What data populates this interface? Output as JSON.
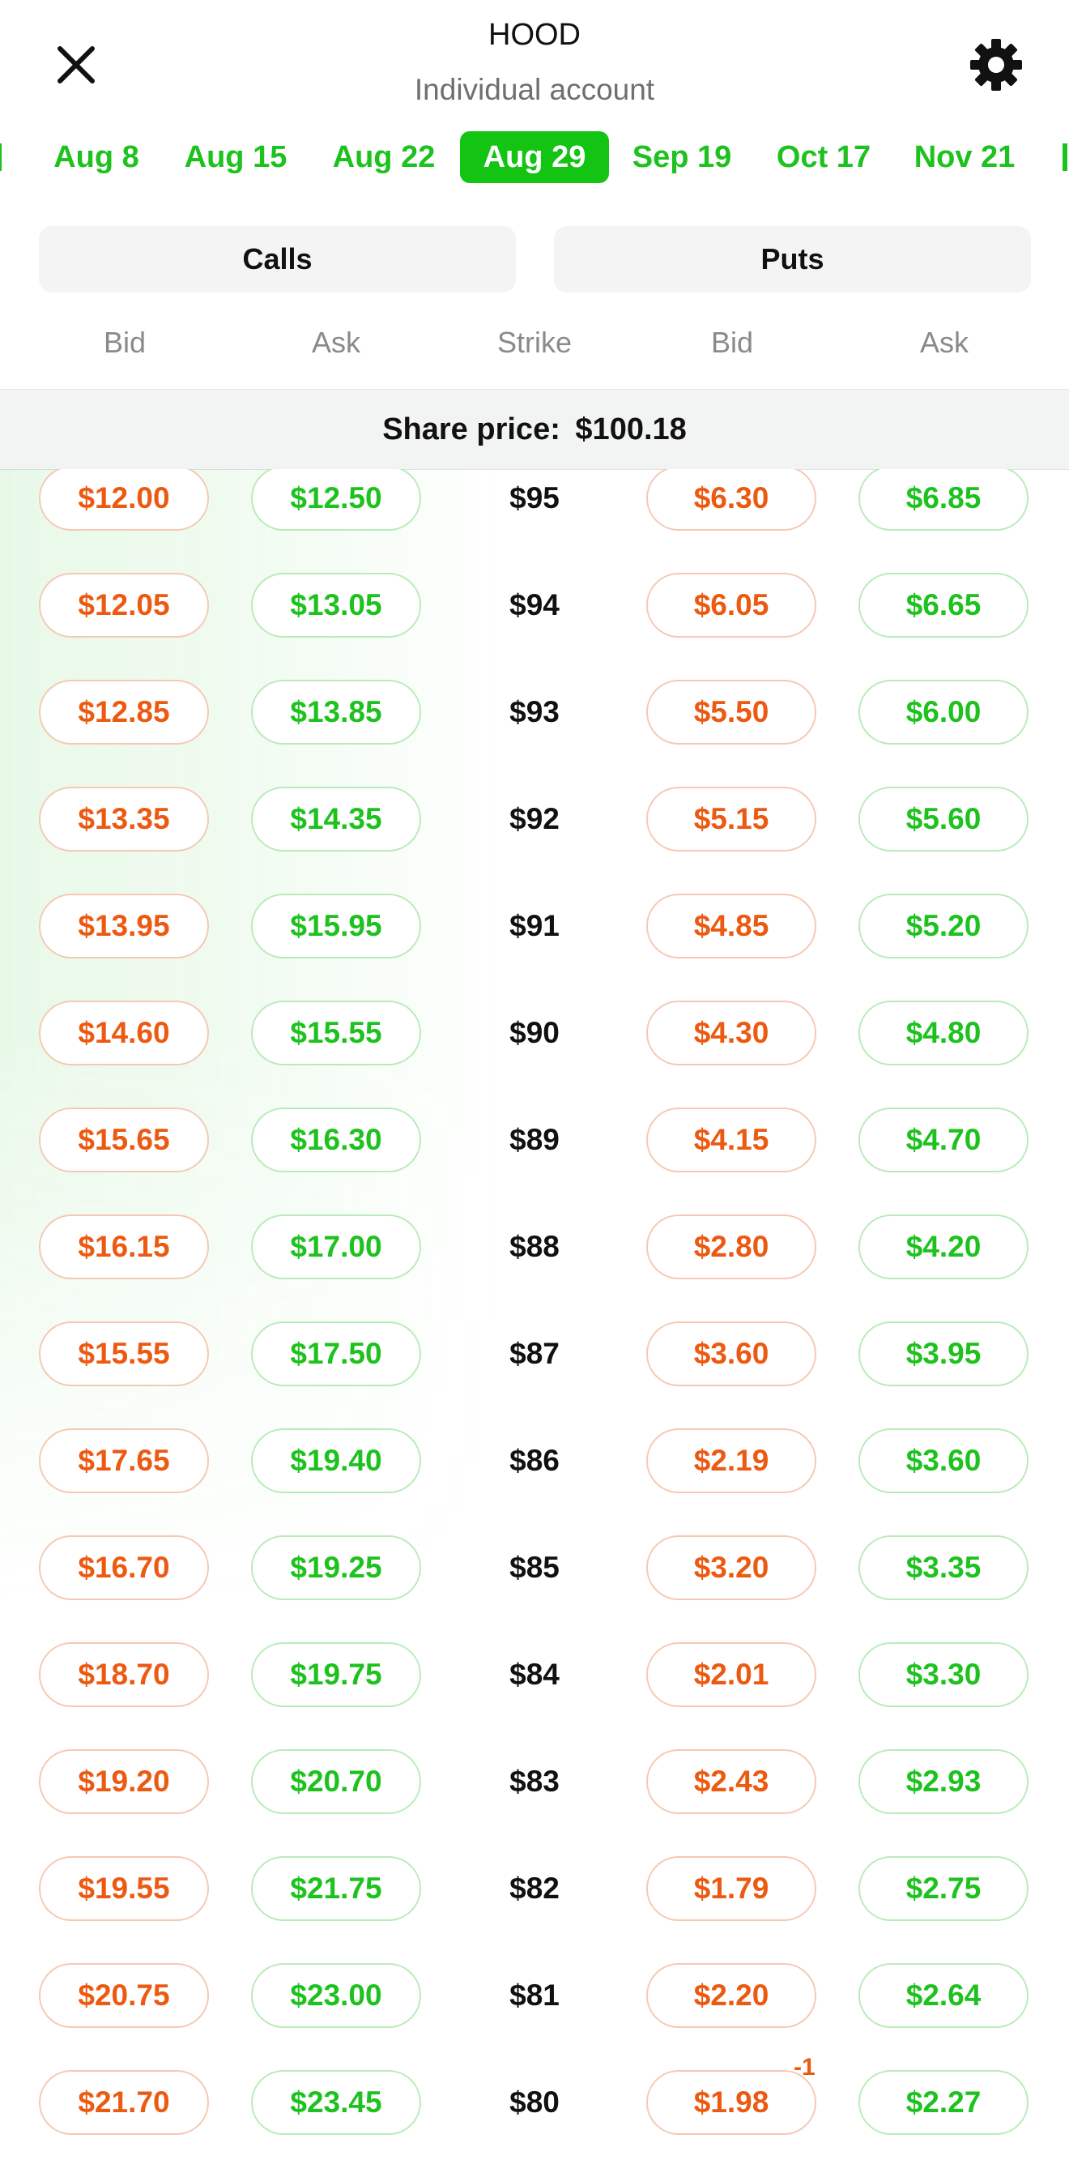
{
  "header": {
    "title": "HOOD",
    "subtitle": "Individual account",
    "close_icon": "close-icon",
    "settings_icon": "gear-icon"
  },
  "expirations": [
    "Aug 8",
    "Aug 15",
    "Aug 22",
    "Aug 29",
    "Sep 19",
    "Oct 17",
    "Nov 21"
  ],
  "selected_expiration": "Aug 29",
  "option_type": {
    "calls_label": "Calls",
    "puts_label": "Puts"
  },
  "columns": {
    "call_bid": "Bid",
    "call_ask": "Ask",
    "strike": "Strike",
    "put_bid": "Bid",
    "put_ask": "Ask"
  },
  "share_price": {
    "label": "Share price:",
    "value": "$100.18"
  },
  "rows": [
    {
      "call_bid": "$12.00",
      "call_ask": "$12.50",
      "strike": "$95",
      "put_bid": "$6.30",
      "put_ask": "$6.85"
    },
    {
      "call_bid": "$12.05",
      "call_ask": "$13.05",
      "strike": "$94",
      "put_bid": "$6.05",
      "put_ask": "$6.65"
    },
    {
      "call_bid": "$12.85",
      "call_ask": "$13.85",
      "strike": "$93",
      "put_bid": "$5.50",
      "put_ask": "$6.00"
    },
    {
      "call_bid": "$13.35",
      "call_ask": "$14.35",
      "strike": "$92",
      "put_bid": "$5.15",
      "put_ask": "$5.60"
    },
    {
      "call_bid": "$13.95",
      "call_ask": "$15.95",
      "strike": "$91",
      "put_bid": "$4.85",
      "put_ask": "$5.20"
    },
    {
      "call_bid": "$14.60",
      "call_ask": "$15.55",
      "strike": "$90",
      "put_bid": "$4.30",
      "put_ask": "$4.80"
    },
    {
      "call_bid": "$15.65",
      "call_ask": "$16.30",
      "strike": "$89",
      "put_bid": "$4.15",
      "put_ask": "$4.70"
    },
    {
      "call_bid": "$16.15",
      "call_ask": "$17.00",
      "strike": "$88",
      "put_bid": "$2.80",
      "put_ask": "$4.20"
    },
    {
      "call_bid": "$15.55",
      "call_ask": "$17.50",
      "strike": "$87",
      "put_bid": "$3.60",
      "put_ask": "$3.95"
    },
    {
      "call_bid": "$17.65",
      "call_ask": "$19.40",
      "strike": "$86",
      "put_bid": "$2.19",
      "put_ask": "$3.60"
    },
    {
      "call_bid": "$16.70",
      "call_ask": "$19.25",
      "strike": "$85",
      "put_bid": "$3.20",
      "put_ask": "$3.35"
    },
    {
      "call_bid": "$18.70",
      "call_ask": "$19.75",
      "strike": "$84",
      "put_bid": "$2.01",
      "put_ask": "$3.30"
    },
    {
      "call_bid": "$19.20",
      "call_ask": "$20.70",
      "strike": "$83",
      "put_bid": "$2.43",
      "put_ask": "$2.93"
    },
    {
      "call_bid": "$19.55",
      "call_ask": "$21.75",
      "strike": "$82",
      "put_bid": "$1.79",
      "put_ask": "$2.75"
    },
    {
      "call_bid": "$20.75",
      "call_ask": "$23.00",
      "strike": "$81",
      "put_bid": "$2.20",
      "put_ask": "$2.64"
    },
    {
      "call_bid": "$21.70",
      "call_ask": "$23.45",
      "strike": "$80",
      "put_bid": "$1.98",
      "put_ask": "$2.27",
      "put_bid_badge": "-1"
    }
  ],
  "colors": {
    "green": "#1ec21e",
    "orange": "#ec5a12",
    "selected_tab_bg": "#13c413"
  }
}
